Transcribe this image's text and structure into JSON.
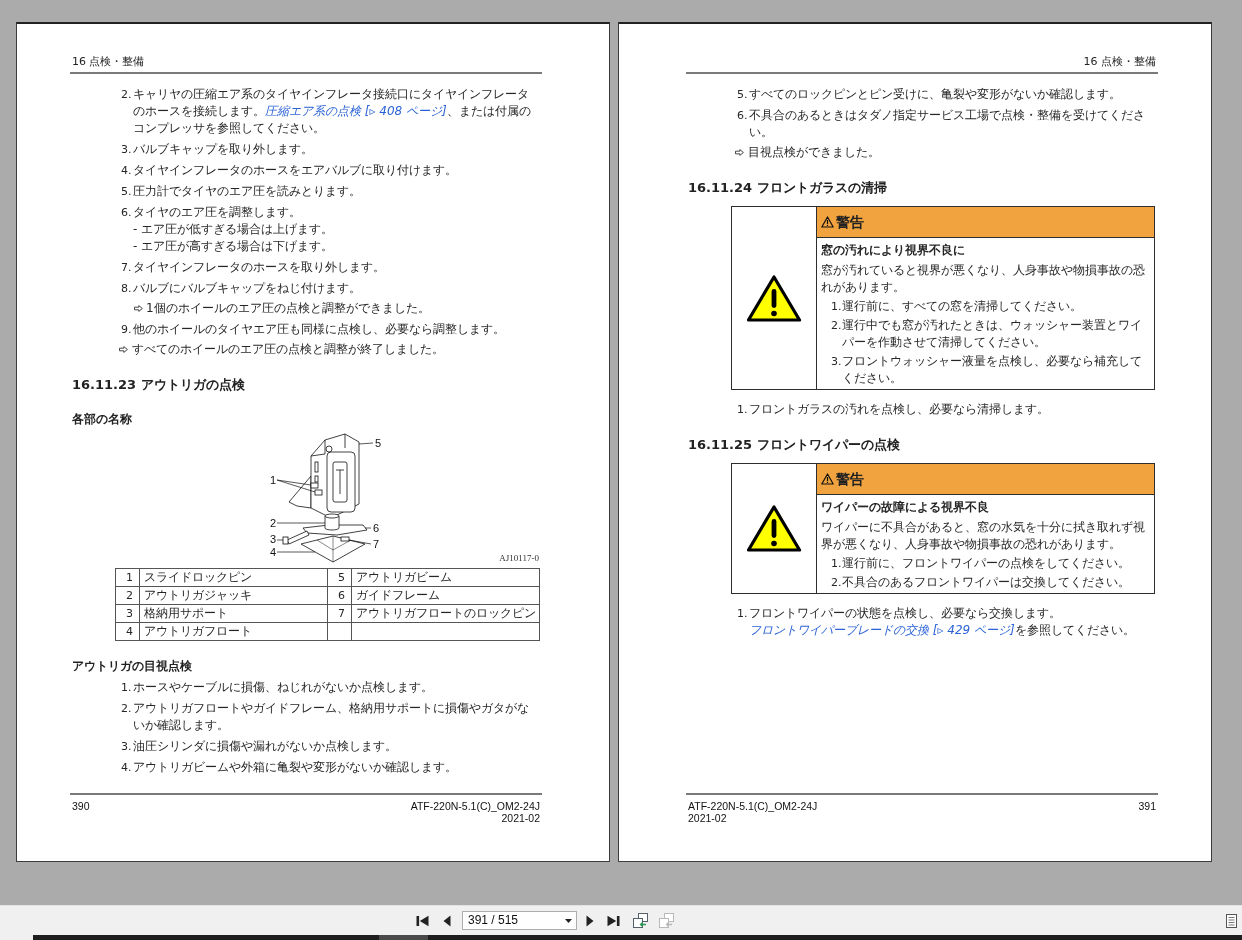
{
  "pages": [
    {
      "kind": "left",
      "header": "16 点検・整備",
      "content": [
        {
          "kind": "steps",
          "items": [
            {
              "kind": "step",
              "number": "2.",
              "text": "キャリヤの圧縮エア系のタイヤインフレータ接続口にタイヤインフレータのホースを接続します。",
              "link": "圧縮エア系の点検 [▹ 408 ページ]",
              "text_after": "、または付属のコンプレッサを参照してください。"
            },
            {
              "kind": "step",
              "number": "3.",
              "text": "バルブキャップを取り外します。"
            },
            {
              "kind": "step",
              "number": "4.",
              "text": "タイヤインフレータのホースをエアバルブに取り付けます。"
            },
            {
              "kind": "step",
              "number": "5.",
              "text": "圧力計でタイヤのエア圧を読みとります。"
            },
            {
              "kind": "step",
              "number": "6.",
              "text": "タイヤのエア圧を調整します。",
              "children": [
                {
                  "kind": "line",
                  "text": "- エア圧が低すぎる場合は上げます。"
                },
                {
                  "kind": "line",
                  "text": "- エア圧が高すぎる場合は下げます。"
                }
              ]
            },
            {
              "kind": "step",
              "number": "7.",
              "text": "タイヤインフレータのホースを取り外します。"
            },
            {
              "kind": "step",
              "number": "8.",
              "text": "バルブにバルブキャップをねじ付けます。",
              "children": [
                {
                  "kind": "result",
                  "text": "1個のホイールのエア圧の点検と調整ができました。"
                }
              ]
            },
            {
              "kind": "step",
              "number": "9.",
              "text": "他のホイールのタイヤエア圧も同様に点検し、必要なら調整します。"
            },
            {
              "kind": "result",
              "text": "すべてのホイールのエア圧の点検と調整が終了しました。"
            }
          ]
        },
        {
          "kind": "heading",
          "text": "16.11.23 アウトリガの点検"
        },
        {
          "kind": "subheading",
          "text": "各部の名称"
        },
        {
          "kind": "figure",
          "callouts": [
            "5",
            "1",
            "2",
            "6",
            "3",
            "7",
            "4"
          ],
          "code": "AJ10117-0"
        },
        {
          "kind": "parts_table",
          "rows": [
            [
              "1",
              "スライドロックピン",
              "5",
              "アウトリガビーム"
            ],
            [
              "2",
              "アウトリガジャッキ",
              "6",
              "ガイドフレーム"
            ],
            [
              "3",
              "格納用サポート",
              "7",
              "アウトリガフロートのロックピン"
            ],
            [
              "4",
              "アウトリガフロート"
            ]
          ]
        },
        {
          "kind": "subheading",
          "text": "アウトリガの目視点検"
        },
        {
          "kind": "steps",
          "items": [
            {
              "kind": "step",
              "number": "1.",
              "text": "ホースやケーブルに損傷、ねじれがないか点検します。"
            },
            {
              "kind": "step",
              "number": "2.",
              "text": "アウトリガフロートやガイドフレーム、格納用サポートに損傷やガタがないか確認します。"
            },
            {
              "kind": "step",
              "number": "3.",
              "text": "油圧シリンダに損傷や漏れがないか点検します。"
            },
            {
              "kind": "step",
              "number": "4.",
              "text": "アウトリガビームや外箱に亀裂や変形がないか確認します。"
            }
          ]
        }
      ],
      "footer": {
        "page_number": "390",
        "document_code": "ATF-220N-5.1(C)_OM2-24J",
        "date": "2021-02"
      }
    },
    {
      "kind": "right",
      "header": "16 点検・整備",
      "content": [
        {
          "kind": "steps",
          "items": [
            {
              "kind": "step",
              "number": "5.",
              "text": "すべてのロックピンとピン受けに、亀裂や変形がないか確認します。"
            },
            {
              "kind": "step",
              "number": "6.",
              "text": "不具合のあるときはタダノ指定サービス工場で点検・整備を受けてください。"
            },
            {
              "kind": "result",
              "text": "目視点検ができました。"
            }
          ]
        },
        {
          "kind": "heading",
          "text": "16.11.24 フロントガラスの清掃"
        },
        {
          "kind": "warning",
          "signal_word": "警告",
          "title": "窓の汚れにより視界不良に",
          "message": "窓が汚れていると視界が悪くなり、人身事故や物損事故の恐れがあります。",
          "steps": [
            {
              "number": "1.",
              "text": "運行前に、すべての窓を清掃してください。"
            },
            {
              "number": "2.",
              "text": "運行中でも窓が汚れたときは、ウォッシャー装置とワイパーを作動させて清掃してください。"
            },
            {
              "number": "3.",
              "text": "フロントウォッシャー液量を点検し、必要なら補充してください。"
            }
          ]
        },
        {
          "kind": "steps",
          "items": [
            {
              "kind": "step",
              "number": "1.",
              "text": "フロントガラスの汚れを点検し、必要なら清掃します。"
            }
          ]
        },
        {
          "kind": "heading",
          "text": "16.11.25 フロントワイパーの点検"
        },
        {
          "kind": "warning",
          "signal_word": "警告",
          "title": "ワイパーの故障による視界不良",
          "message": "ワイパーに不具合があると、窓の水気を十分に拭き取れず視界が悪くなり、人身事故や物損事故の恐れがあります。",
          "steps": [
            {
              "number": "1.",
              "text": "運行前に、フロントワイパーの点検をしてください。"
            },
            {
              "number": "2.",
              "text": "不具合のあるフロントワイパーは交換してください。"
            }
          ]
        },
        {
          "kind": "steps",
          "items": [
            {
              "kind": "step",
              "number": "1.",
              "text": "フロントワイパーの状態を点検し、必要なら交換します。",
              "link": "フロントワイパーブレードの交換 [▹ 429 ページ]",
              "text_after": "を参照してください。"
            }
          ]
        }
      ],
      "footer": {
        "page_number": "391",
        "document_code": "ATF-220N-5.1(C)_OM2-24J",
        "date": "2021-02"
      }
    }
  ],
  "toolbar": {
    "page_field": "391 / 515",
    "view_buttons": [
      {
        "disabled": false
      },
      {
        "disabled": true
      }
    ]
  }
}
